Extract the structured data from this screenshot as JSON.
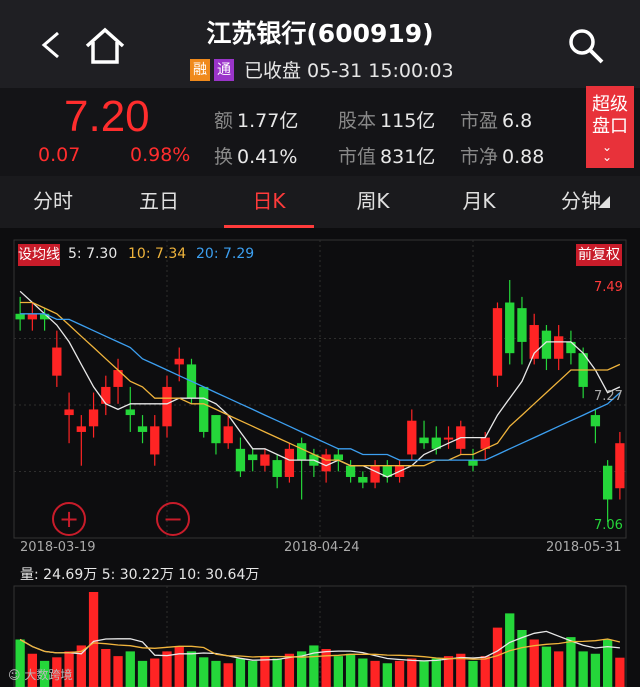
{
  "header": {
    "title": "江苏银行(600919)",
    "tag_rong": "融",
    "tag_tong": "通",
    "status": "已收盘 05-31 15:00:03"
  },
  "quote": {
    "price": "7.20",
    "change": "0.07",
    "change_pct": "0.98%",
    "amount_label": "额",
    "amount": "1.77亿",
    "turnover_label": "换",
    "turnover": "0.41%",
    "share_capital_label": "股本",
    "share_capital": "115亿",
    "market_cap_label": "市值",
    "market_cap": "831亿",
    "pe_label": "市盈",
    "pe": "6.8",
    "pb_label": "市净",
    "pb": "0.88",
    "super_button_line1": "超级",
    "super_button_line2": "盘口"
  },
  "tabs": [
    "分时",
    "五日",
    "日K",
    "周K",
    "月K",
    "分钟"
  ],
  "active_tab": "日K",
  "ma_bar": {
    "set_label": "设均线",
    "ma5": "5: 7.30",
    "ma10": "10: 7.34",
    "ma20": "20: 7.29",
    "adjust_label": "前复权"
  },
  "price_labels": {
    "high": "7.49",
    "mid": "7.27",
    "low": "7.06"
  },
  "dates": [
    "2018-03-19",
    "2018-04-24",
    "2018-05-31"
  ],
  "volume_bar": "量: 24.69万  5: 30.22万  10: 30.64万",
  "watermark": "大数跨境",
  "colors": {
    "up": "#ff2424",
    "down": "#25d63a",
    "ma5": "#e8e8e8",
    "ma10": "#f0b43c",
    "ma20": "#3c9ff0"
  },
  "chart_data": {
    "type": "candlestick",
    "x": [
      "2018-03-19",
      "2018-03-20",
      "2018-03-21",
      "2018-03-22",
      "2018-03-23",
      "2018-03-26",
      "2018-03-27",
      "2018-03-28",
      "2018-03-29",
      "2018-03-30",
      "2018-04-02",
      "2018-04-03",
      "2018-04-04",
      "2018-04-09",
      "2018-04-10",
      "2018-04-11",
      "2018-04-12",
      "2018-04-13",
      "2018-04-16",
      "2018-04-17",
      "2018-04-18",
      "2018-04-19",
      "2018-04-20",
      "2018-04-23",
      "2018-04-24",
      "2018-04-25",
      "2018-04-26",
      "2018-04-27",
      "2018-05-02",
      "2018-05-03",
      "2018-05-04",
      "2018-05-07",
      "2018-05-08",
      "2018-05-09",
      "2018-05-10",
      "2018-05-11",
      "2018-05-14",
      "2018-05-15",
      "2018-05-16",
      "2018-05-17",
      "2018-05-18",
      "2018-05-21",
      "2018-05-22",
      "2018-05-23",
      "2018-05-24",
      "2018-05-25",
      "2018-05-28",
      "2018-05-29",
      "2018-05-30",
      "2018-05-31"
    ],
    "open": [
      7.43,
      7.42,
      7.43,
      7.32,
      7.25,
      7.22,
      7.23,
      7.27,
      7.3,
      7.26,
      7.23,
      7.18,
      7.23,
      7.34,
      7.34,
      7.3,
      7.25,
      7.2,
      7.19,
      7.18,
      7.16,
      7.17,
      7.14,
      7.2,
      7.18,
      7.15,
      7.18,
      7.16,
      7.14,
      7.13,
      7.16,
      7.14,
      7.18,
      7.21,
      7.21,
      7.21,
      7.19,
      7.17,
      7.19,
      7.32,
      7.45,
      7.44,
      7.35,
      7.4,
      7.35,
      7.38,
      7.36,
      7.25,
      7.16,
      7.12
    ],
    "close": [
      7.42,
      7.43,
      7.42,
      7.37,
      7.26,
      7.23,
      7.26,
      7.3,
      7.33,
      7.25,
      7.22,
      7.23,
      7.3,
      7.35,
      7.28,
      7.22,
      7.2,
      7.23,
      7.15,
      7.17,
      7.18,
      7.14,
      7.19,
      7.17,
      7.16,
      7.18,
      7.17,
      7.14,
      7.13,
      7.16,
      7.14,
      7.16,
      7.24,
      7.2,
      7.19,
      7.21,
      7.23,
      7.16,
      7.21,
      7.44,
      7.36,
      7.38,
      7.41,
      7.35,
      7.39,
      7.36,
      7.3,
      7.23,
      7.1,
      7.2
    ],
    "high": [
      7.46,
      7.45,
      7.44,
      7.4,
      7.29,
      7.25,
      7.29,
      7.32,
      7.35,
      7.3,
      7.25,
      7.25,
      7.32,
      7.37,
      7.35,
      7.3,
      7.25,
      7.25,
      7.21,
      7.19,
      7.19,
      7.18,
      7.2,
      7.21,
      7.19,
      7.19,
      7.19,
      7.17,
      7.15,
      7.17,
      7.17,
      7.17,
      7.26,
      7.24,
      7.23,
      7.23,
      7.24,
      7.19,
      7.22,
      7.45,
      7.49,
      7.46,
      7.43,
      7.41,
      7.41,
      7.4,
      7.37,
      7.26,
      7.17,
      7.22
    ],
    "low": [
      7.4,
      7.4,
      7.4,
      7.3,
      7.2,
      7.16,
      7.21,
      7.25,
      7.27,
      7.22,
      7.2,
      7.16,
      7.21,
      7.31,
      7.27,
      7.21,
      7.18,
      7.19,
      7.14,
      7.15,
      7.15,
      7.12,
      7.13,
      7.1,
      7.14,
      7.13,
      7.15,
      7.13,
      7.12,
      7.12,
      7.13,
      7.13,
      7.17,
      7.19,
      7.18,
      7.19,
      7.18,
      7.15,
      7.17,
      7.3,
      7.34,
      7.34,
      7.34,
      7.33,
      7.33,
      7.34,
      7.28,
      7.2,
      7.06,
      7.1
    ],
    "ma5": [
      7.47,
      7.45,
      7.43,
      7.41,
      7.38,
      7.34,
      7.3,
      7.27,
      7.26,
      7.27,
      7.27,
      7.27,
      7.27,
      7.28,
      7.28,
      7.28,
      7.27,
      7.25,
      7.22,
      7.19,
      7.19,
      7.18,
      7.17,
      7.17,
      7.17,
      7.16,
      7.17,
      7.16,
      7.16,
      7.15,
      7.14,
      7.15,
      7.16,
      7.18,
      7.19,
      7.2,
      7.21,
      7.21,
      7.21,
      7.25,
      7.28,
      7.31,
      7.36,
      7.38,
      7.38,
      7.38,
      7.36,
      7.33,
      7.29,
      7.3
    ],
    "ma10": [
      7.45,
      7.45,
      7.44,
      7.43,
      7.41,
      7.39,
      7.37,
      7.35,
      7.33,
      7.31,
      7.3,
      7.28,
      7.28,
      7.28,
      7.27,
      7.27,
      7.26,
      7.25,
      7.24,
      7.23,
      7.22,
      7.21,
      7.2,
      7.19,
      7.18,
      7.17,
      7.17,
      7.16,
      7.16,
      7.16,
      7.16,
      7.16,
      7.16,
      7.16,
      7.17,
      7.17,
      7.18,
      7.18,
      7.19,
      7.2,
      7.23,
      7.25,
      7.27,
      7.29,
      7.31,
      7.33,
      7.33,
      7.33,
      7.33,
      7.34
    ],
    "ma20": [
      7.43,
      7.43,
      7.43,
      7.42,
      7.42,
      7.41,
      7.4,
      7.39,
      7.38,
      7.37,
      7.35,
      7.34,
      7.33,
      7.32,
      7.31,
      7.3,
      7.29,
      7.28,
      7.27,
      7.26,
      7.25,
      7.24,
      7.23,
      7.22,
      7.21,
      7.2,
      7.19,
      7.19,
      7.18,
      7.18,
      7.18,
      7.17,
      7.17,
      7.17,
      7.17,
      7.17,
      7.17,
      7.17,
      7.17,
      7.18,
      7.19,
      7.2,
      7.21,
      7.22,
      7.23,
      7.24,
      7.25,
      7.26,
      7.27,
      7.29
    ],
    "volume": [
      40,
      28,
      22,
      25,
      30,
      35,
      80,
      32,
      26,
      30,
      22,
      24,
      30,
      34,
      30,
      25,
      22,
      20,
      24,
      22,
      26,
      24,
      28,
      30,
      35,
      32,
      26,
      28,
      24,
      22,
      20,
      22,
      24,
      22,
      24,
      26,
      28,
      22,
      26,
      50,
      62,
      48,
      40,
      34,
      30,
      42,
      30,
      28,
      40,
      24.69
    ],
    "ylim": [
      7.06,
      7.49
    ]
  }
}
